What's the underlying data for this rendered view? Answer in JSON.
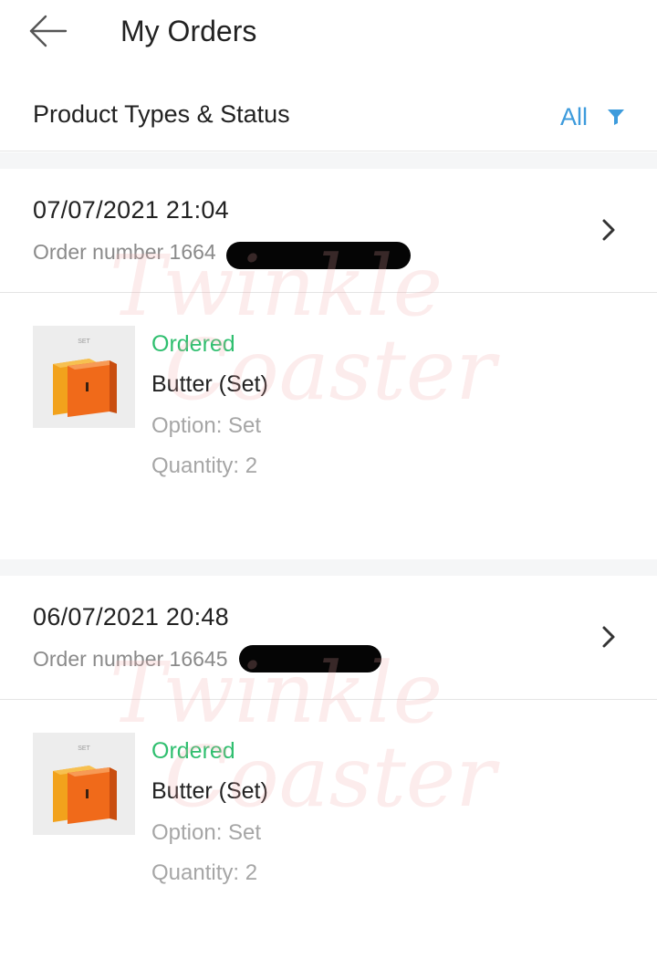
{
  "header": {
    "title": "My Orders",
    "back_icon": "back-arrow-icon"
  },
  "filter": {
    "label": "Product Types & Status",
    "value": "All",
    "icon": "filter-funnel-icon",
    "accent_color": "#3d9bdc"
  },
  "watermark": {
    "line1": "Twinkle",
    "line2": "Coaster"
  },
  "orders": [
    {
      "date": "07/07/2021 21:04",
      "order_number": "Order number 1664",
      "status": "Ordered",
      "product_name": "Butter (Set)",
      "option": "Option: Set",
      "quantity": "Quantity: 2",
      "thumb_label": "SET"
    },
    {
      "date": "06/07/2021 20:48",
      "order_number": "Order number 16645",
      "status": "Ordered",
      "product_name": "Butter (Set)",
      "option": "Option: Set",
      "quantity": "Quantity: 2",
      "thumb_label": "SET"
    }
  ],
  "colors": {
    "status_green": "#2fbf6f",
    "muted_text": "#a6a6a6",
    "separator": "#f5f6f7"
  }
}
